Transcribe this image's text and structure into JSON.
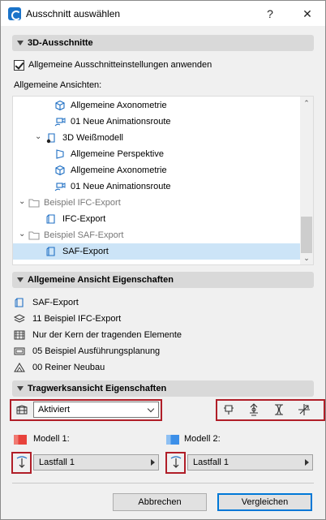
{
  "window": {
    "title": "Ausschnitt auswählen",
    "help_label": "?",
    "close_label": "✕"
  },
  "section_3d": {
    "title": "3D-Ausschnitte",
    "apply_checkbox_label": "Allgemeine Ausschnitteinstellungen anwenden",
    "apply_checked": true,
    "views_label": "Allgemeine Ansichten:"
  },
  "tree": [
    {
      "label": "Allgemeine Axonometrie",
      "icon": "axonometry-icon",
      "style": "normal"
    },
    {
      "label": "01 Neue Animationsroute",
      "icon": "camera-path-icon",
      "style": "normal"
    },
    {
      "label": "3D Weißmodell",
      "icon": "3d-model-icon",
      "style": "normal"
    },
    {
      "label": "Allgemeine Perspektive",
      "icon": "perspective-icon",
      "style": "normal"
    },
    {
      "label": "Allgemeine Axonometrie",
      "icon": "axonometry-icon",
      "style": "normal"
    },
    {
      "label": "01 Neue Animationsroute",
      "icon": "camera-path-icon",
      "style": "normal"
    },
    {
      "label": "Beispiel IFC-Export",
      "icon": "folder-icon",
      "style": "grey"
    },
    {
      "label": "IFC-Export",
      "icon": "view-icon",
      "style": "normal"
    },
    {
      "label": "Beispiel SAF-Export",
      "icon": "folder-icon",
      "style": "grey"
    },
    {
      "label": "SAF-Export",
      "icon": "view-icon",
      "style": "selected"
    }
  ],
  "general_props": {
    "title": "Allgemeine Ansicht Eigenschaften",
    "rows": [
      {
        "label": "SAF-Export",
        "icon": "view-icon"
      },
      {
        "label": "11 Beispiel IFC-Export",
        "icon": "layer-combination-icon"
      },
      {
        "label": "Nur der Kern der tragenden Elemente",
        "icon": "partial-structure-icon"
      },
      {
        "label": "05 Beispiel Ausführungsplanung",
        "icon": "model-view-options-icon"
      },
      {
        "label": "00 Reiner Neubau",
        "icon": "renovation-filter-icon"
      }
    ]
  },
  "structural_props": {
    "title": "Tragwerksansicht Eigenschaften",
    "mode_value": "Aktiviert",
    "model1_label": "Modell 1:",
    "model1_color": "#e8423b",
    "model1_value": "Lastfall 1",
    "model2_label": "Modell 2:",
    "model2_color": "#3c8fe8",
    "model2_value": "Lastfall 1"
  },
  "footer": {
    "cancel_label": "Abbrechen",
    "compare_label": "Vergleichen"
  }
}
